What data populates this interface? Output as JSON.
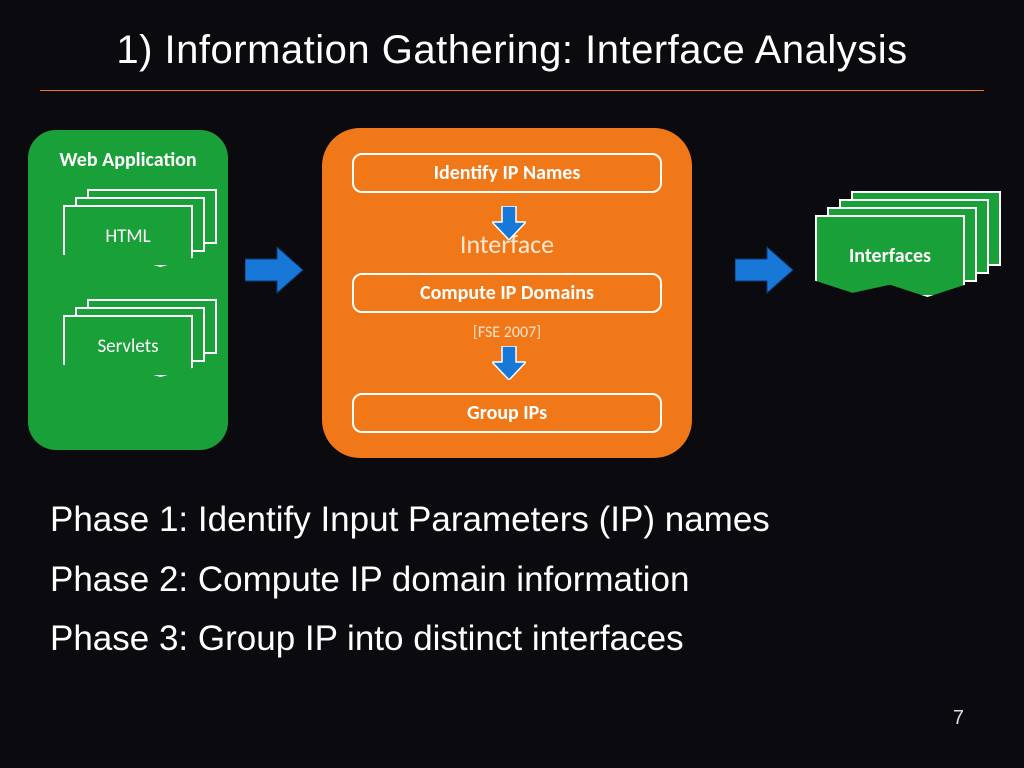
{
  "slide": {
    "title": "1) Information Gathering: Interface Analysis",
    "page_number": "7"
  },
  "webapp": {
    "title": "Web Application",
    "stack1": "HTML",
    "stack2": "Servlets"
  },
  "center": {
    "bg_label": "Interface",
    "citation": "[FSE 2007]",
    "step1": "Identify IP Names",
    "step2": "Compute IP Domains",
    "step3": "Group IPs"
  },
  "interfaces": {
    "label": "Interfaces"
  },
  "phases": {
    "p1": "Phase 1: Identify Input Parameters (IP) names",
    "p2": "Phase 2: Compute IP domain information",
    "p3": "Phase 3: Group IP into distinct interfaces"
  }
}
